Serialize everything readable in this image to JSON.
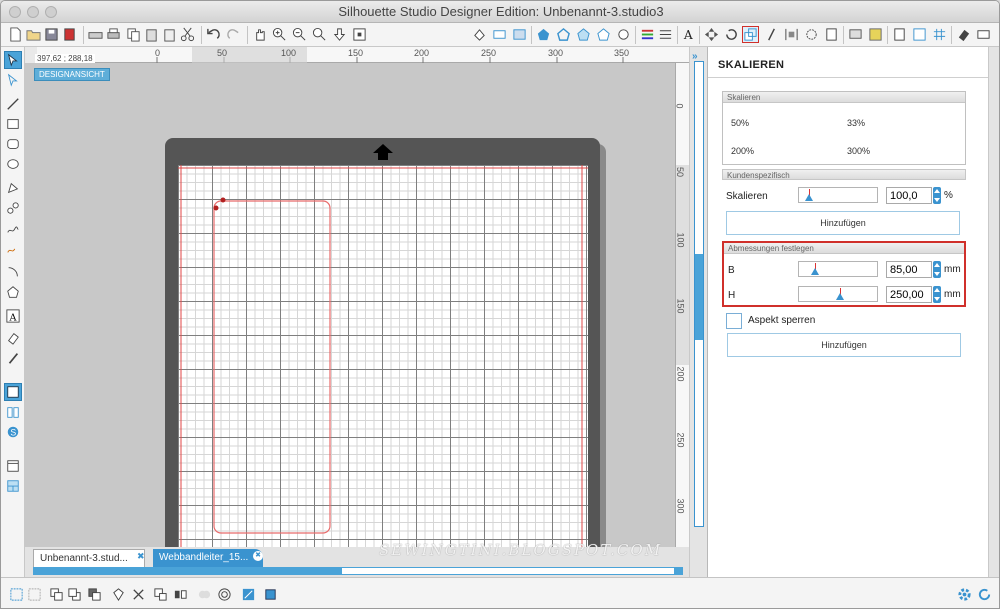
{
  "window": {
    "title": "Silhouette Studio Designer Edition: Unbenannt-3.studio3"
  },
  "canvas": {
    "coords": "397,62 ; 288,18",
    "view_badge": "DESIGNANSICHT",
    "h_ruler_labels": [
      "0",
      "50",
      "100",
      "150",
      "200",
      "250",
      "300",
      "350"
    ],
    "v_ruler_labels": [
      "0",
      "50",
      "100",
      "150",
      "200",
      "250",
      "300"
    ]
  },
  "tabs": [
    {
      "label": "Unbenannt-3.stud...",
      "active": true
    },
    {
      "label": "Webbandleiter_15...",
      "active": false
    }
  ],
  "watermark": "SEWINGTINI.BLOGSPOT.COM",
  "panel": {
    "title": "SKALIEREN",
    "scale_section": {
      "header": "Skalieren",
      "presets": [
        "50%",
        "33%",
        "200%",
        "300%"
      ]
    },
    "custom_section": {
      "header": "Kundenspezifisch",
      "label": "Skalieren",
      "value": "100,0",
      "unit": "%",
      "button": "Hinzufügen"
    },
    "dimensions_section": {
      "header": "Abmessungen festlegen",
      "width_label": "B",
      "width_value": "85,00",
      "height_label": "H",
      "height_value": "250,00",
      "unit": "mm"
    },
    "lock_aspect_label": "Aspekt sperren",
    "lock_aspect_checked": false,
    "add_button": "Hinzufügen"
  },
  "colors": {
    "accent": "#3a93cf",
    "highlight_red": "#d0302b"
  }
}
